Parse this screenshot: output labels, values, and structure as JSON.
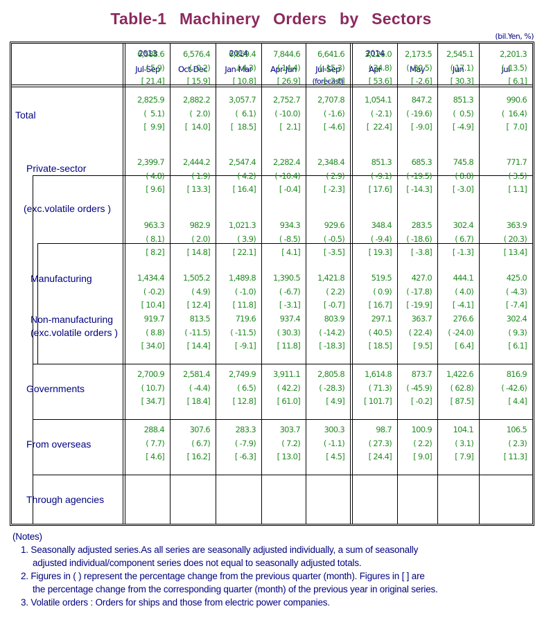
{
  "title": "Table-1   Machinery   Orders   by   Sectors",
  "unit": "(bil.Yen, %)",
  "columns": [
    {
      "year": "2013",
      "period": "Jul-Sep",
      "note": ""
    },
    {
      "year": "",
      "period": "Oct-Dec",
      "note": ""
    },
    {
      "year": "2014",
      "period": "Jan-Mar",
      "note": ""
    },
    {
      "year": "",
      "period": "Apr-Jun",
      "note": ""
    },
    {
      "year": "",
      "period": "Jul-Sep",
      "note": "(forecast)"
    },
    {
      "year": "2014",
      "period": "Apr",
      "note": ""
    },
    {
      "year": "",
      "period": "May",
      "note": ""
    },
    {
      "year": "",
      "period": "Jun",
      "note": ""
    },
    {
      "year": "",
      "period": "Jul",
      "note": ""
    }
  ],
  "rows": [
    {
      "label": "Total",
      "label2": "",
      "values": [
        "6,588.6",
        "6,576.4",
        "6,859.4",
        "7,844.6",
        "6,641.6",
        "3,126.0",
        "2,173.5",
        "2,545.1",
        "2,201.3"
      ],
      "qoq": [
        "( 5.9)",
        "( -0.2)",
        "( 4.3)",
        "( 14.4)",
        "( -15.3)",
        "( 34.8)",
        "( -30.5)",
        "( 17.1)",
        "( -13.5)"
      ],
      "yoy": [
        "[ 21.4]",
        "[ 15.9]",
        "[ 10.8]",
        "[ 26.9]",
        "[ -2.0]",
        "[ 53.6]",
        "[ -2.6]",
        "[ 30.3]",
        "[ 6.1]"
      ]
    },
    {
      "label": "Private-sector",
      "label2": "",
      "values": [
        "2,825.9",
        "2,882.2",
        "3,057.7",
        "2,752.7",
        "2,707.8",
        "1,054.1",
        "847.2",
        "851.3",
        "990.6"
      ],
      "qoq": [
        "(  5.1)",
        "(  2.0)",
        "(  6.1)",
        "( -10.0)",
        "( -1.6)",
        "( -2.1)",
        "( -19.6)",
        "(  0.5)",
        "(  16.4)"
      ],
      "yoy": [
        "[  9.9]",
        "[  14.0]",
        "[  18.5]",
        "[  2.1]",
        "[ -4.6]",
        "[  22.4]",
        "[ -9.0]",
        "[ -4.9]",
        "[  7.0]"
      ]
    },
    {
      "label": "(exc.volatile orders )",
      "label2": "",
      "values": [
        "2,399.7",
        "2,444.2",
        "2,547.4",
        "2,282.4",
        "2,348.4",
        "851.3",
        "685.3",
        "745.8",
        "771.7"
      ],
      "qoq": [
        "( 4.8)",
        "( 1.9)",
        "( 4.2)",
        "( -10.4)",
        "( 2.9)",
        "( -9.1)",
        "( -19.5)",
        "( 8.8)",
        "( 3.5)"
      ],
      "yoy": [
        "[ 9.6]",
        "[ 13.3]",
        "[ 16.4]",
        "[ -0.4]",
        "[ -2.3]",
        "[ 17.6]",
        "[ -14.3]",
        "[ -3.0]",
        "[ 1.1]"
      ]
    },
    {
      "label": "Manufacturing",
      "label2": "",
      "values": [
        "963.3",
        "982.9",
        "1,021.3",
        "934.3",
        "929.6",
        "348.4",
        "283.5",
        "302.4",
        "363.9"
      ],
      "qoq": [
        "( 8.1)",
        "( 2.0)",
        "( 3.9)",
        "( -8.5)",
        "( -0.5)",
        "( -9.4)",
        "( -18.6)",
        "( 6.7)",
        "( 20.3)"
      ],
      "yoy": [
        "[ 8.2]",
        "[ 14.8]",
        "[ 22.1]",
        "[ 4.1]",
        "[ -3.5]",
        "[ 19.3]",
        "[ -3.8]",
        "[ -1.3]",
        "[ 13.4]"
      ]
    },
    {
      "label": "Non-manufacturing",
      "label2": "(exc.volatile orders )",
      "values": [
        "1,434.4",
        "1,505.2",
        "1,489.8",
        "1,390.5",
        "1,421.8",
        "519.5",
        "427.0",
        "444.1",
        "425.0"
      ],
      "qoq": [
        "( -0.2)",
        "( 4.9)",
        "( -1.0)",
        "( -6.7)",
        "( 2.2)",
        "( 0.9)",
        "( -17.8)",
        "( 4.0)",
        "( -4.3)"
      ],
      "yoy": [
        "[ 10.4]",
        "[ 12.4]",
        "[ 11.8]",
        "[ -3.1]",
        "[ -0.7]",
        "[ 16.7]",
        "[ -19.9]",
        "[ -4.1]",
        "[ -7.4]"
      ]
    },
    {
      "label": "Governments",
      "label2": "",
      "values": [
        "919.7",
        "813.5",
        "719.6",
        "937.4",
        "803.9",
        "297.1",
        "363.7",
        "276.6",
        "302.4"
      ],
      "qoq": [
        "( 8.8)",
        "( -11.5)",
        "( -11.5)",
        "( 30.3)",
        "( -14.2)",
        "( 40.5)",
        "( 22.4)",
        "( -24.0)",
        "( 9.3)"
      ],
      "yoy": [
        "[ 34.0]",
        "[ 14.4]",
        "[ -9.1]",
        "[ 11.8]",
        "[ -18.3]",
        "[ 18.5]",
        "[ 9.5]",
        "[ 6.4]",
        "[ 6.1]"
      ]
    },
    {
      "label": "From overseas",
      "label2": "",
      "values": [
        "2,700.9",
        "2,581.4",
        "2,749.9",
        "3,911.1",
        "2,805.8",
        "1,614.8",
        "873.7",
        "1,422.6",
        "816.9"
      ],
      "qoq": [
        "( 10.7)",
        "( -4.4)",
        "( 6.5)",
        "( 42.2)",
        "( -28.3)",
        "( 71.3)",
        "( -45.9)",
        "( 62.8)",
        "( -42.6)"
      ],
      "yoy": [
        "[ 34.7]",
        "[ 18.4]",
        "[ 12.8]",
        "[ 61.0]",
        "[ 4.9]",
        "[ 101.7]",
        "[ -0.2]",
        "[ 87.5]",
        "[ 4.4]"
      ]
    },
    {
      "label": "Through agencies",
      "label2": "",
      "values": [
        "288.4",
        "307.6",
        "283.3",
        "303.7",
        "300.3",
        "98.7",
        "100.9",
        "104.1",
        "106.5"
      ],
      "qoq": [
        "( 7.7)",
        "( 6.7)",
        "( -7.9)",
        "( 7.2)",
        "( -1.1)",
        "( 27.3)",
        "( 2.2)",
        "( 3.1)",
        "( 2.3)"
      ],
      "yoy": [
        "[ 4.6]",
        "[ 16.2]",
        "[ -6.3]",
        "[ 13.0]",
        "[ 4.5]",
        "[ 24.4]",
        "[ 9.0]",
        "[ 7.9]",
        "[ 11.3]"
      ]
    }
  ],
  "notes": {
    "heading": "(Notes)",
    "items": [
      {
        "line1": "1. Seasonally adjusted series.As all series are seasonally adjusted individually, a sum of seasonally",
        "line2": "adjusted individual/component series does not equal to seasonally adjusted totals."
      },
      {
        "line1": "2. Figures in ( ) represent the percentage change from the previous quarter (month). Figures in [ ] are",
        "line2": "the percentage change from the corresponding quarter (month) of the previous year in original series."
      },
      {
        "line1": "3. Volatile orders : Orders for ships and those from electric power companies.",
        "line2": ""
      }
    ]
  }
}
